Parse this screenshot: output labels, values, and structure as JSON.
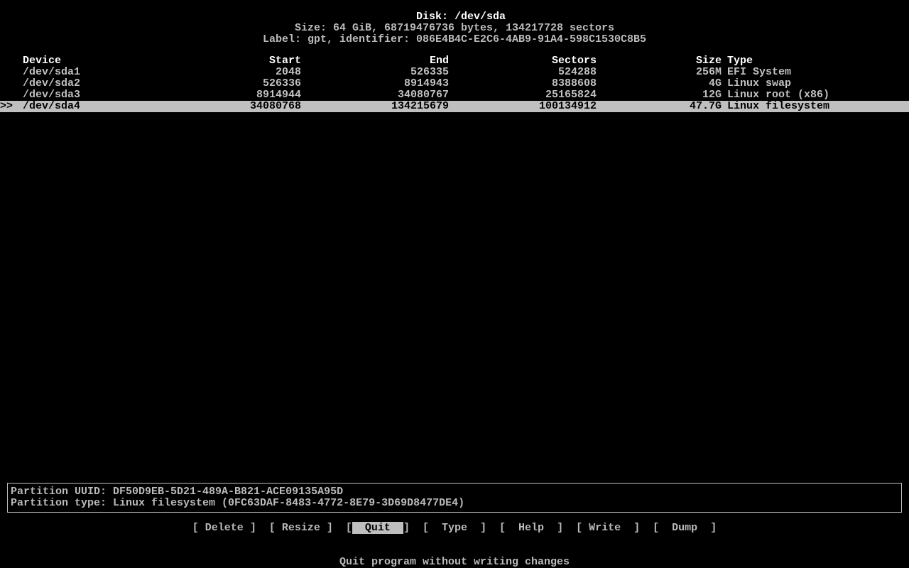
{
  "header": {
    "disk_label_prefix": "Disk: ",
    "disk": "/dev/sda",
    "size_line": "Size: 64 GiB, 68719476736 bytes, 134217728 sectors",
    "label_line": "Label: gpt, identifier: 086E4B4C-E2C6-4AB9-91A4-598C1530C8B5"
  },
  "columns": {
    "device": "Device",
    "start": "Start",
    "end": "End",
    "sectors": "Sectors",
    "size": "Size",
    "type": "Type"
  },
  "partitions": [
    {
      "device": "/dev/sda1",
      "start": "2048",
      "end": "526335",
      "sectors": "524288",
      "size": "256M",
      "type": "EFI System",
      "selected": false
    },
    {
      "device": "/dev/sda2",
      "start": "526336",
      "end": "8914943",
      "sectors": "8388608",
      "size": "4G",
      "type": "Linux swap",
      "selected": false
    },
    {
      "device": "/dev/sda3",
      "start": "8914944",
      "end": "34080767",
      "sectors": "25165824",
      "size": "12G",
      "type": "Linux root (x86)",
      "selected": false
    },
    {
      "device": "/dev/sda4",
      "start": "34080768",
      "end": "134215679",
      "sectors": "100134912",
      "size": "47.7G",
      "type": "Linux filesystem",
      "selected": true
    }
  ],
  "selection_marker": ">>",
  "info": {
    "uuid_line": "Partition UUID: DF50D9EB-5D21-489A-B821-ACE09135A95D",
    "type_line": "Partition type: Linux filesystem (0FC63DAF-8483-4772-8E79-3D69D8477DE4)"
  },
  "menu": {
    "items": [
      {
        "label": "Delete",
        "selected": false
      },
      {
        "label": "Resize",
        "selected": false
      },
      {
        "label": "Quit",
        "selected": true
      },
      {
        "label": "Type",
        "selected": false
      },
      {
        "label": "Help",
        "selected": false
      },
      {
        "label": "Write",
        "selected": false
      },
      {
        "label": "Dump",
        "selected": false
      }
    ]
  },
  "hint": "Quit program without writing changes"
}
